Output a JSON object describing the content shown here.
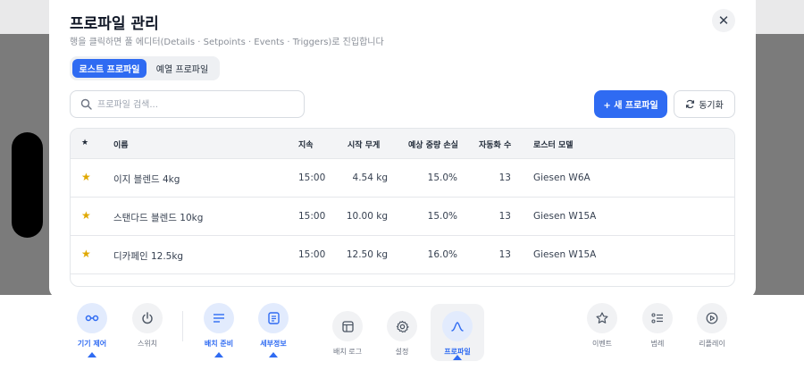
{
  "dialog": {
    "title": "프로파일 관리",
    "subtitle": "행을 클릭하면 풀 에디터(Details · Setpoints · Events · Triggers)로 진입합니다",
    "close_label": "✕"
  },
  "tabs": [
    {
      "label": "로스트 프로파일",
      "active": true
    },
    {
      "label": "예열 프로파일",
      "active": false
    }
  ],
  "search": {
    "placeholder": "프로파일 검색...",
    "value": ""
  },
  "buttons": {
    "new_label": "+ 새 프로파일",
    "sync_label": "동기화"
  },
  "table": {
    "columns": [
      "★",
      "이름",
      "지속",
      "시작 무게",
      "예상 중량 손실",
      "자동화 수",
      "로스터 모델"
    ],
    "rows": [
      {
        "star": "★",
        "name": "이지 블렌드 4kg",
        "duration": "15:00",
        "start_weight": "4.54 kg",
        "loss": "15.0%",
        "automations": "13",
        "model": "Giesen W6A"
      },
      {
        "star": "★",
        "name": "스탠다드 블렌드 10kg",
        "duration": "15:00",
        "start_weight": "10.00 kg",
        "loss": "15.0%",
        "automations": "13",
        "model": "Giesen W15A"
      },
      {
        "star": "★",
        "name": "디카페인 12.5kg",
        "duration": "15:00",
        "start_weight": "12.50 kg",
        "loss": "16.0%",
        "automations": "13",
        "model": "Giesen W15A"
      }
    ]
  },
  "bottom_nav": [
    {
      "label": "기기 제어",
      "icon": "link-icon",
      "active": true
    },
    {
      "label": "스위치",
      "icon": "power-icon",
      "active": false
    },
    {
      "label": "배치 준비",
      "icon": "lines-icon",
      "active": true
    },
    {
      "label": "세부정보",
      "icon": "document-icon",
      "active": true
    },
    {
      "label": "배치 로그",
      "icon": "window-icon",
      "active": false
    },
    {
      "label": "설정",
      "icon": "gear-icon",
      "active": false
    },
    {
      "label": "프로파일",
      "icon": "curve-icon",
      "active": true
    },
    {
      "label": "이벤트",
      "icon": "star-icon",
      "active": false
    },
    {
      "label": "범례",
      "icon": "legend-icon",
      "active": false
    },
    {
      "label": "리플레이",
      "icon": "play-icon",
      "active": false
    }
  ],
  "colors": {
    "accent": "#2f6bf2",
    "star": "#e0a800"
  }
}
